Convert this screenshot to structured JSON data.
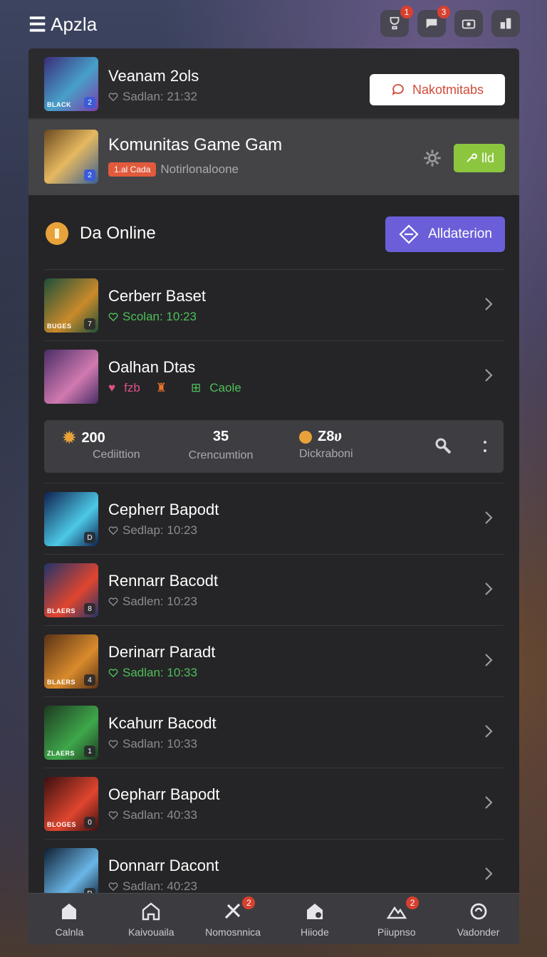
{
  "app": {
    "title": "Apzla"
  },
  "top_actions": [
    {
      "icon": "trophy-icon",
      "badge": "1"
    },
    {
      "icon": "chat-icon",
      "badge": "3"
    },
    {
      "icon": "camera-icon",
      "badge": ""
    },
    {
      "icon": "grid-icon",
      "badge": ""
    }
  ],
  "notification": {
    "title": "Veanam 2ols",
    "time": "Sadlan: 21:32",
    "thumb_tag": "BLACK",
    "thumb_num": "2",
    "button_label": "Nakotmitabs"
  },
  "featured": {
    "title": "Komunitas Game Gam",
    "tag": "1.al Cada",
    "subtitle": "Notirlonaloone",
    "thumb_num": "2",
    "button_label": "lld"
  },
  "section": {
    "title": "Da Online",
    "button_label": "Alldaterion"
  },
  "items_top": [
    {
      "title": "Cerberr Baset",
      "time": "Scolan: 10:23",
      "time_color": "green",
      "thumb_tag": "BUGES",
      "thumb_num": "7",
      "thumb_colors": [
        "#1d4f3a",
        "#c98a2a"
      ]
    },
    {
      "title": "Oalhan Dtas",
      "meta": [
        "fzb",
        "",
        "Caole"
      ],
      "thumb_tag": "",
      "thumb_num": "",
      "thumb_colors": [
        "#4a2d66",
        "#d07ab0"
      ]
    }
  ],
  "stats": [
    {
      "value": "200",
      "label": "Cediittion"
    },
    {
      "value": "35",
      "label": "Crencumtion"
    },
    {
      "value": "Z8ሀ",
      "label": "Dickraboni"
    }
  ],
  "items_bottom": [
    {
      "title": "Cepherr Bapodt",
      "time": "Sedlap: 10:23",
      "time_color": "grey",
      "thumb_tag": "",
      "thumb_num": "D",
      "thumb_colors": [
        "#0f2150",
        "#4cc9e6"
      ]
    },
    {
      "title": "Rennarr Bacodt",
      "time": "Sadlen: 10:23",
      "time_color": "grey",
      "thumb_tag": "BLAERS",
      "thumb_num": "8",
      "thumb_colors": [
        "#22346a",
        "#e0452e"
      ]
    },
    {
      "title": "Derinarr Paradt",
      "time": "Sadlan: 10:33",
      "time_color": "green",
      "thumb_tag": "BLAERS",
      "thumb_num": "4",
      "thumb_colors": [
        "#5a3216",
        "#d98b2c"
      ]
    },
    {
      "title": "Kcahurr Bacodt",
      "time": "Sadlan: 10:33",
      "time_color": "grey",
      "thumb_tag": "ZLAERS",
      "thumb_num": "1",
      "thumb_colors": [
        "#1e3a22",
        "#3ea84a"
      ]
    },
    {
      "title": "Oepharr Bapodt",
      "time": "Sadlan: 40:33",
      "time_color": "grey",
      "thumb_tag": "BLOGES",
      "thumb_num": "0",
      "thumb_colors": [
        "#3a1010",
        "#e0452e"
      ]
    },
    {
      "title": "Donnarr Dacont",
      "time": "Sadlan: 40:23",
      "time_color": "grey",
      "thumb_tag": "",
      "thumb_num": "D",
      "thumb_colors": [
        "#0f1f33",
        "#6ab6e6"
      ]
    }
  ],
  "bottom_nav": [
    {
      "label": "Calnla",
      "icon": "home-icon",
      "badge": ""
    },
    {
      "label": "Kaivouaila",
      "icon": "store-icon",
      "badge": ""
    },
    {
      "label": "Nomosnnica",
      "icon": "tools-icon",
      "badge": "2"
    },
    {
      "label": "Hiiode",
      "icon": "house-gear-icon",
      "badge": ""
    },
    {
      "label": "Piiupnso",
      "icon": "group-icon",
      "badge": "2"
    },
    {
      "label": "Vadonder",
      "icon": "refresh-icon",
      "badge": ""
    }
  ],
  "colors": {
    "accent_purple": "#6a5fd9",
    "accent_green": "#8cc63f",
    "badge_red": "#d8402f",
    "panel": "#252527"
  }
}
